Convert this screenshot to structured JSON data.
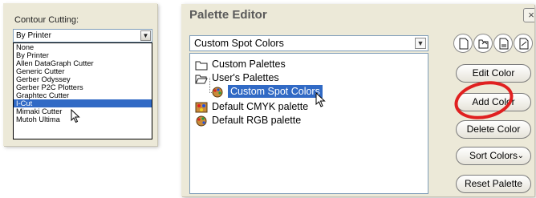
{
  "contour": {
    "label": "Contour Cutting:",
    "selected": "By Printer",
    "options": [
      "None",
      "By Printer",
      "Allen DataGraph Cutter",
      "Generic Cutter",
      "Gerber Odyssey",
      "Gerber P2C Plotters",
      "Graphtec Cutter",
      "I-Cut",
      "Mimaki Cutter",
      "Mutoh Ultima"
    ],
    "highlighted_index": 7
  },
  "palette_editor": {
    "title": "Palette Editor",
    "close_glyph": "×",
    "selected_palette": "Custom Spot Colors",
    "tree": {
      "custom_palettes": "Custom Palettes",
      "users_palettes": "User's Palettes",
      "custom_spot_colors": "Custom Spot Colors",
      "default_cmyk": "Default CMYK palette",
      "default_rgb": "Default RGB palette"
    },
    "buttons": {
      "edit_color": "Edit Color",
      "add_color": "Add Color",
      "delete_color": "Delete Color",
      "sort_colors": "Sort Colors",
      "reset_palette": "Reset Palette"
    },
    "icons": [
      "new-palette-icon",
      "open-palette-icon",
      "save-palette-icon",
      "save-as-palette-icon"
    ],
    "annotation_color": "#e02020",
    "selection_color": "#316ac5"
  }
}
